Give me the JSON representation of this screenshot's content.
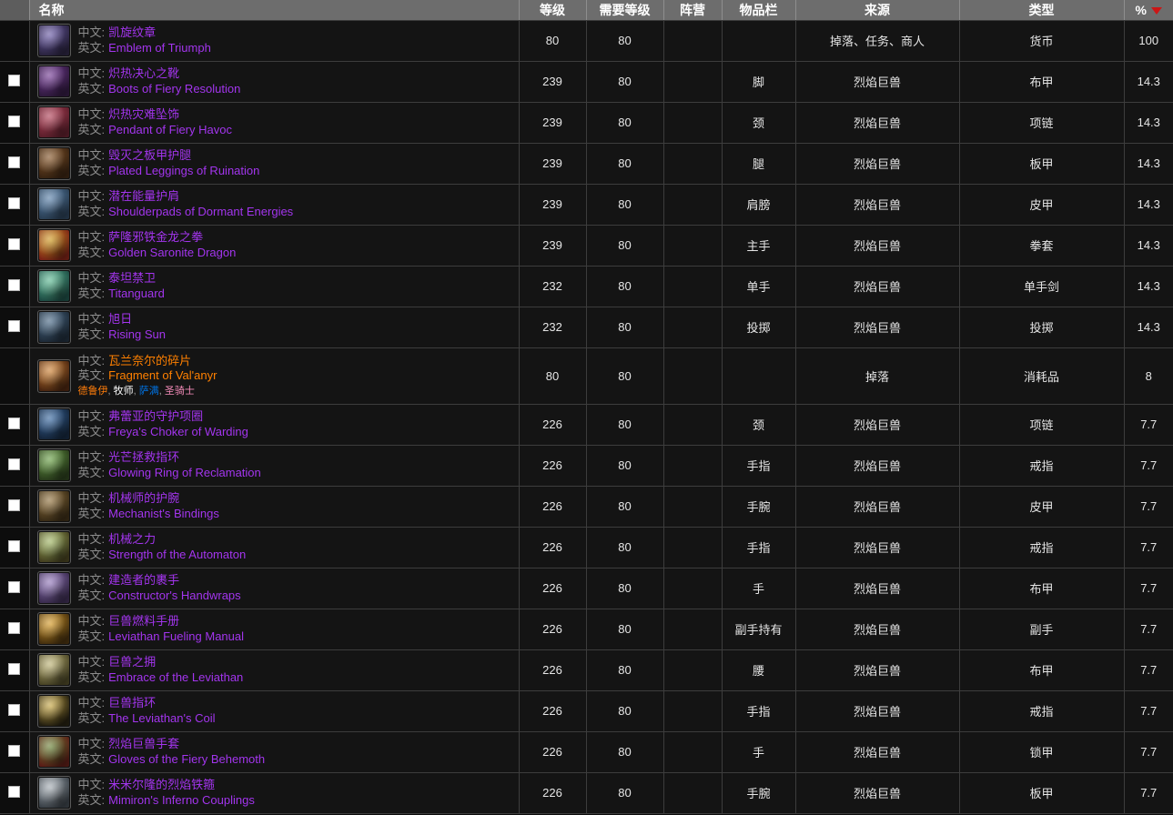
{
  "table": {
    "columns": [
      {
        "key": "check",
        "label": ""
      },
      {
        "key": "name",
        "label": "名称"
      },
      {
        "key": "level",
        "label": "等级"
      },
      {
        "key": "req",
        "label": "需要等级"
      },
      {
        "key": "faction",
        "label": "阵营"
      },
      {
        "key": "slot",
        "label": "物品栏"
      },
      {
        "key": "source",
        "label": "来源"
      },
      {
        "key": "type",
        "label": "类型"
      },
      {
        "key": "percent",
        "label": "%"
      }
    ],
    "sort": {
      "column": "percent",
      "direction": "desc",
      "arrow_color": "#cc1616"
    },
    "row_labels": {
      "zh": "中文:",
      "en": "英文:"
    },
    "rows": [
      {
        "checkbox": false,
        "icon_name": "emblem-of-triumph-icon",
        "icon_colors": [
          "#6f5fae",
          "#2b2440"
        ],
        "name_zh": "凯旋纹章",
        "name_en": "Emblem of Triumph",
        "quality": "epic",
        "classes": [],
        "level": "80",
        "req": "80",
        "faction": "",
        "slot": "",
        "source": "掉落、任务、商人",
        "type": "货币",
        "percent": "100"
      },
      {
        "checkbox": true,
        "icon_name": "boots-of-fiery-resolution-icon",
        "icon_colors": [
          "#7a3f9c",
          "#311a40"
        ],
        "name_zh": "炽热决心之靴",
        "name_en": "Boots of Fiery Resolution",
        "quality": "epic",
        "classes": [],
        "level": "239",
        "req": "80",
        "faction": "",
        "slot": "脚",
        "source": "烈焰巨兽",
        "type": "布甲",
        "percent": "14.3"
      },
      {
        "checkbox": true,
        "icon_name": "pendant-of-fiery-havoc-icon",
        "icon_colors": [
          "#b8455c",
          "#5e1f2c"
        ],
        "name_zh": "炽热灾难坠饰",
        "name_en": "Pendant of Fiery Havoc",
        "quality": "epic",
        "classes": [],
        "level": "239",
        "req": "80",
        "faction": "",
        "slot": "颈",
        "source": "烈焰巨兽",
        "type": "项链",
        "percent": "14.3"
      },
      {
        "checkbox": true,
        "icon_name": "plated-leggings-of-ruination-icon",
        "icon_colors": [
          "#8b5a2b",
          "#3a2412"
        ],
        "name_zh": "毁灭之板甲护腿",
        "name_en": "Plated Leggings of Ruination",
        "quality": "epic",
        "classes": [],
        "level": "239",
        "req": "80",
        "faction": "",
        "slot": "腿",
        "source": "烈焰巨兽",
        "type": "板甲",
        "percent": "14.3"
      },
      {
        "checkbox": true,
        "icon_name": "shoulderpads-of-dormant-energies-icon",
        "icon_colors": [
          "#5e86b0",
          "#2a3f55"
        ],
        "name_zh": "潜在能量护肩",
        "name_en": "Shoulderpads of Dormant Energies",
        "quality": "epic",
        "classes": [],
        "level": "239",
        "req": "80",
        "faction": "",
        "slot": "肩膀",
        "source": "烈焰巨兽",
        "type": "皮甲",
        "percent": "14.3"
      },
      {
        "checkbox": true,
        "icon_name": "golden-saronite-dragon-icon",
        "icon_colors": [
          "#d8a323",
          "#7a2216"
        ],
        "name_zh": "萨隆邪铁金龙之拳",
        "name_en": "Golden Saronite Dragon",
        "quality": "epic",
        "classes": [],
        "level": "239",
        "req": "80",
        "faction": "",
        "slot": "主手",
        "source": "烈焰巨兽",
        "type": "拳套",
        "percent": "14.3"
      },
      {
        "checkbox": true,
        "icon_name": "titanguard-icon",
        "icon_colors": [
          "#63c39a",
          "#1d4c44"
        ],
        "name_zh": "泰坦禁卫",
        "name_en": "Titanguard",
        "quality": "epic",
        "classes": [],
        "level": "232",
        "req": "80",
        "faction": "",
        "slot": "单手",
        "source": "烈焰巨兽",
        "type": "单手剑",
        "percent": "14.3"
      },
      {
        "checkbox": true,
        "icon_name": "rising-sun-icon",
        "icon_colors": [
          "#4e6f8d",
          "#1f2c3a"
        ],
        "name_zh": "旭日",
        "name_en": "Rising Sun",
        "quality": "epic",
        "classes": [],
        "level": "232",
        "req": "80",
        "faction": "",
        "slot": "投掷",
        "source": "烈焰巨兽",
        "type": "投掷",
        "percent": "14.3"
      },
      {
        "checkbox": false,
        "icon_name": "fragment-of-valanyr-icon",
        "icon_colors": [
          "#d98b3a",
          "#4a2510"
        ],
        "name_zh": "瓦兰奈尔的碎片",
        "name_en": "Fragment of Val'anyr",
        "quality": "legendary",
        "classes": [
          {
            "label": "德鲁伊",
            "color_class": "cls-druid"
          },
          {
            "label": "牧师",
            "color_class": "cls-priest"
          },
          {
            "label": "萨满",
            "color_class": "cls-shaman"
          },
          {
            "label": "圣骑士",
            "color_class": "cls-paladin"
          }
        ],
        "level": "80",
        "req": "80",
        "faction": "",
        "slot": "",
        "source": "掉落",
        "type": "消耗品",
        "percent": "8"
      },
      {
        "checkbox": true,
        "icon_name": "freyas-choker-of-warding-icon",
        "icon_colors": [
          "#3c6ea8",
          "#15263c"
        ],
        "name_zh": "弗蕾亚的守护项圈",
        "name_en": "Freya's Choker of Warding",
        "quality": "epic",
        "classes": [],
        "level": "226",
        "req": "80",
        "faction": "",
        "slot": "颈",
        "source": "烈焰巨兽",
        "type": "项链",
        "percent": "7.7"
      },
      {
        "checkbox": true,
        "icon_name": "glowing-ring-of-reclamation-icon",
        "icon_colors": [
          "#6fa84a",
          "#2a3d1c"
        ],
        "name_zh": "光芒拯救指环",
        "name_en": "Glowing Ring of Reclamation",
        "quality": "epic",
        "classes": [],
        "level": "226",
        "req": "80",
        "faction": "",
        "slot": "手指",
        "source": "烈焰巨兽",
        "type": "戒指",
        "percent": "7.7"
      },
      {
        "checkbox": true,
        "icon_name": "mechanists-bindings-icon",
        "icon_colors": [
          "#9a7a44",
          "#3a2c16"
        ],
        "name_zh": "机械师的护腕",
        "name_en": "Mechanist's Bindings",
        "quality": "epic",
        "classes": [],
        "level": "226",
        "req": "80",
        "faction": "",
        "slot": "手腕",
        "source": "烈焰巨兽",
        "type": "皮甲",
        "percent": "7.7"
      },
      {
        "checkbox": true,
        "icon_name": "strength-of-the-automaton-icon",
        "icon_colors": [
          "#a9c06a",
          "#45401f"
        ],
        "name_zh": "机械之力",
        "name_en": "Strength of the Automaton",
        "quality": "epic",
        "classes": [],
        "level": "226",
        "req": "80",
        "faction": "",
        "slot": "手指",
        "source": "烈焰巨兽",
        "type": "戒指",
        "percent": "7.7"
      },
      {
        "checkbox": true,
        "icon_name": "constructors-handwraps-icon",
        "icon_colors": [
          "#9b7fc4",
          "#3b2c50"
        ],
        "name_zh": "建造者的裹手",
        "name_en": "Constructor's Handwraps",
        "quality": "epic",
        "classes": [],
        "level": "226",
        "req": "80",
        "faction": "",
        "slot": "手",
        "source": "烈焰巨兽",
        "type": "布甲",
        "percent": "7.7"
      },
      {
        "checkbox": true,
        "icon_name": "leviathan-fueling-manual-icon",
        "icon_colors": [
          "#e0a32a",
          "#46300f"
        ],
        "name_zh": "巨兽燃料手册",
        "name_en": "Leviathan Fueling Manual",
        "quality": "epic",
        "classes": [],
        "level": "226",
        "req": "80",
        "faction": "",
        "slot": "副手持有",
        "source": "烈焰巨兽",
        "type": "副手",
        "percent": "7.7"
      },
      {
        "checkbox": true,
        "icon_name": "embrace-of-the-leviathan-icon",
        "icon_colors": [
          "#c7bd7c",
          "#4a4526"
        ],
        "name_zh": "巨兽之拥",
        "name_en": "Embrace of the Leviathan",
        "quality": "epic",
        "classes": [],
        "level": "226",
        "req": "80",
        "faction": "",
        "slot": "腰",
        "source": "烈焰巨兽",
        "type": "布甲",
        "percent": "7.7"
      },
      {
        "checkbox": true,
        "icon_name": "the-leviathans-coil-icon",
        "icon_colors": [
          "#d3b24a",
          "#241f10"
        ],
        "name_zh": "巨兽指环",
        "name_en": "The Leviathan's Coil",
        "quality": "epic",
        "classes": [],
        "level": "226",
        "req": "80",
        "faction": "",
        "slot": "手指",
        "source": "烈焰巨兽",
        "type": "戒指",
        "percent": "7.7"
      },
      {
        "checkbox": true,
        "icon_name": "gloves-of-the-fiery-behemoth-icon",
        "icon_colors": [
          "#6f8b3c",
          "#5a1d16"
        ],
        "name_zh": "烈焰巨兽手套",
        "name_en": "Gloves of the Fiery Behemoth",
        "quality": "epic",
        "classes": [],
        "level": "226",
        "req": "80",
        "faction": "",
        "slot": "手",
        "source": "烈焰巨兽",
        "type": "锁甲",
        "percent": "7.7"
      },
      {
        "checkbox": true,
        "icon_name": "mimirons-inferno-couplings-icon",
        "icon_colors": [
          "#aeb6bd",
          "#3a4148"
        ],
        "name_zh": "米米尔隆的烈焰铁箍",
        "name_en": "Mimiron's Inferno Couplings",
        "quality": "epic",
        "classes": [],
        "level": "226",
        "req": "80",
        "faction": "",
        "slot": "手腕",
        "source": "烈焰巨兽",
        "type": "板甲",
        "percent": "7.7"
      }
    ]
  }
}
